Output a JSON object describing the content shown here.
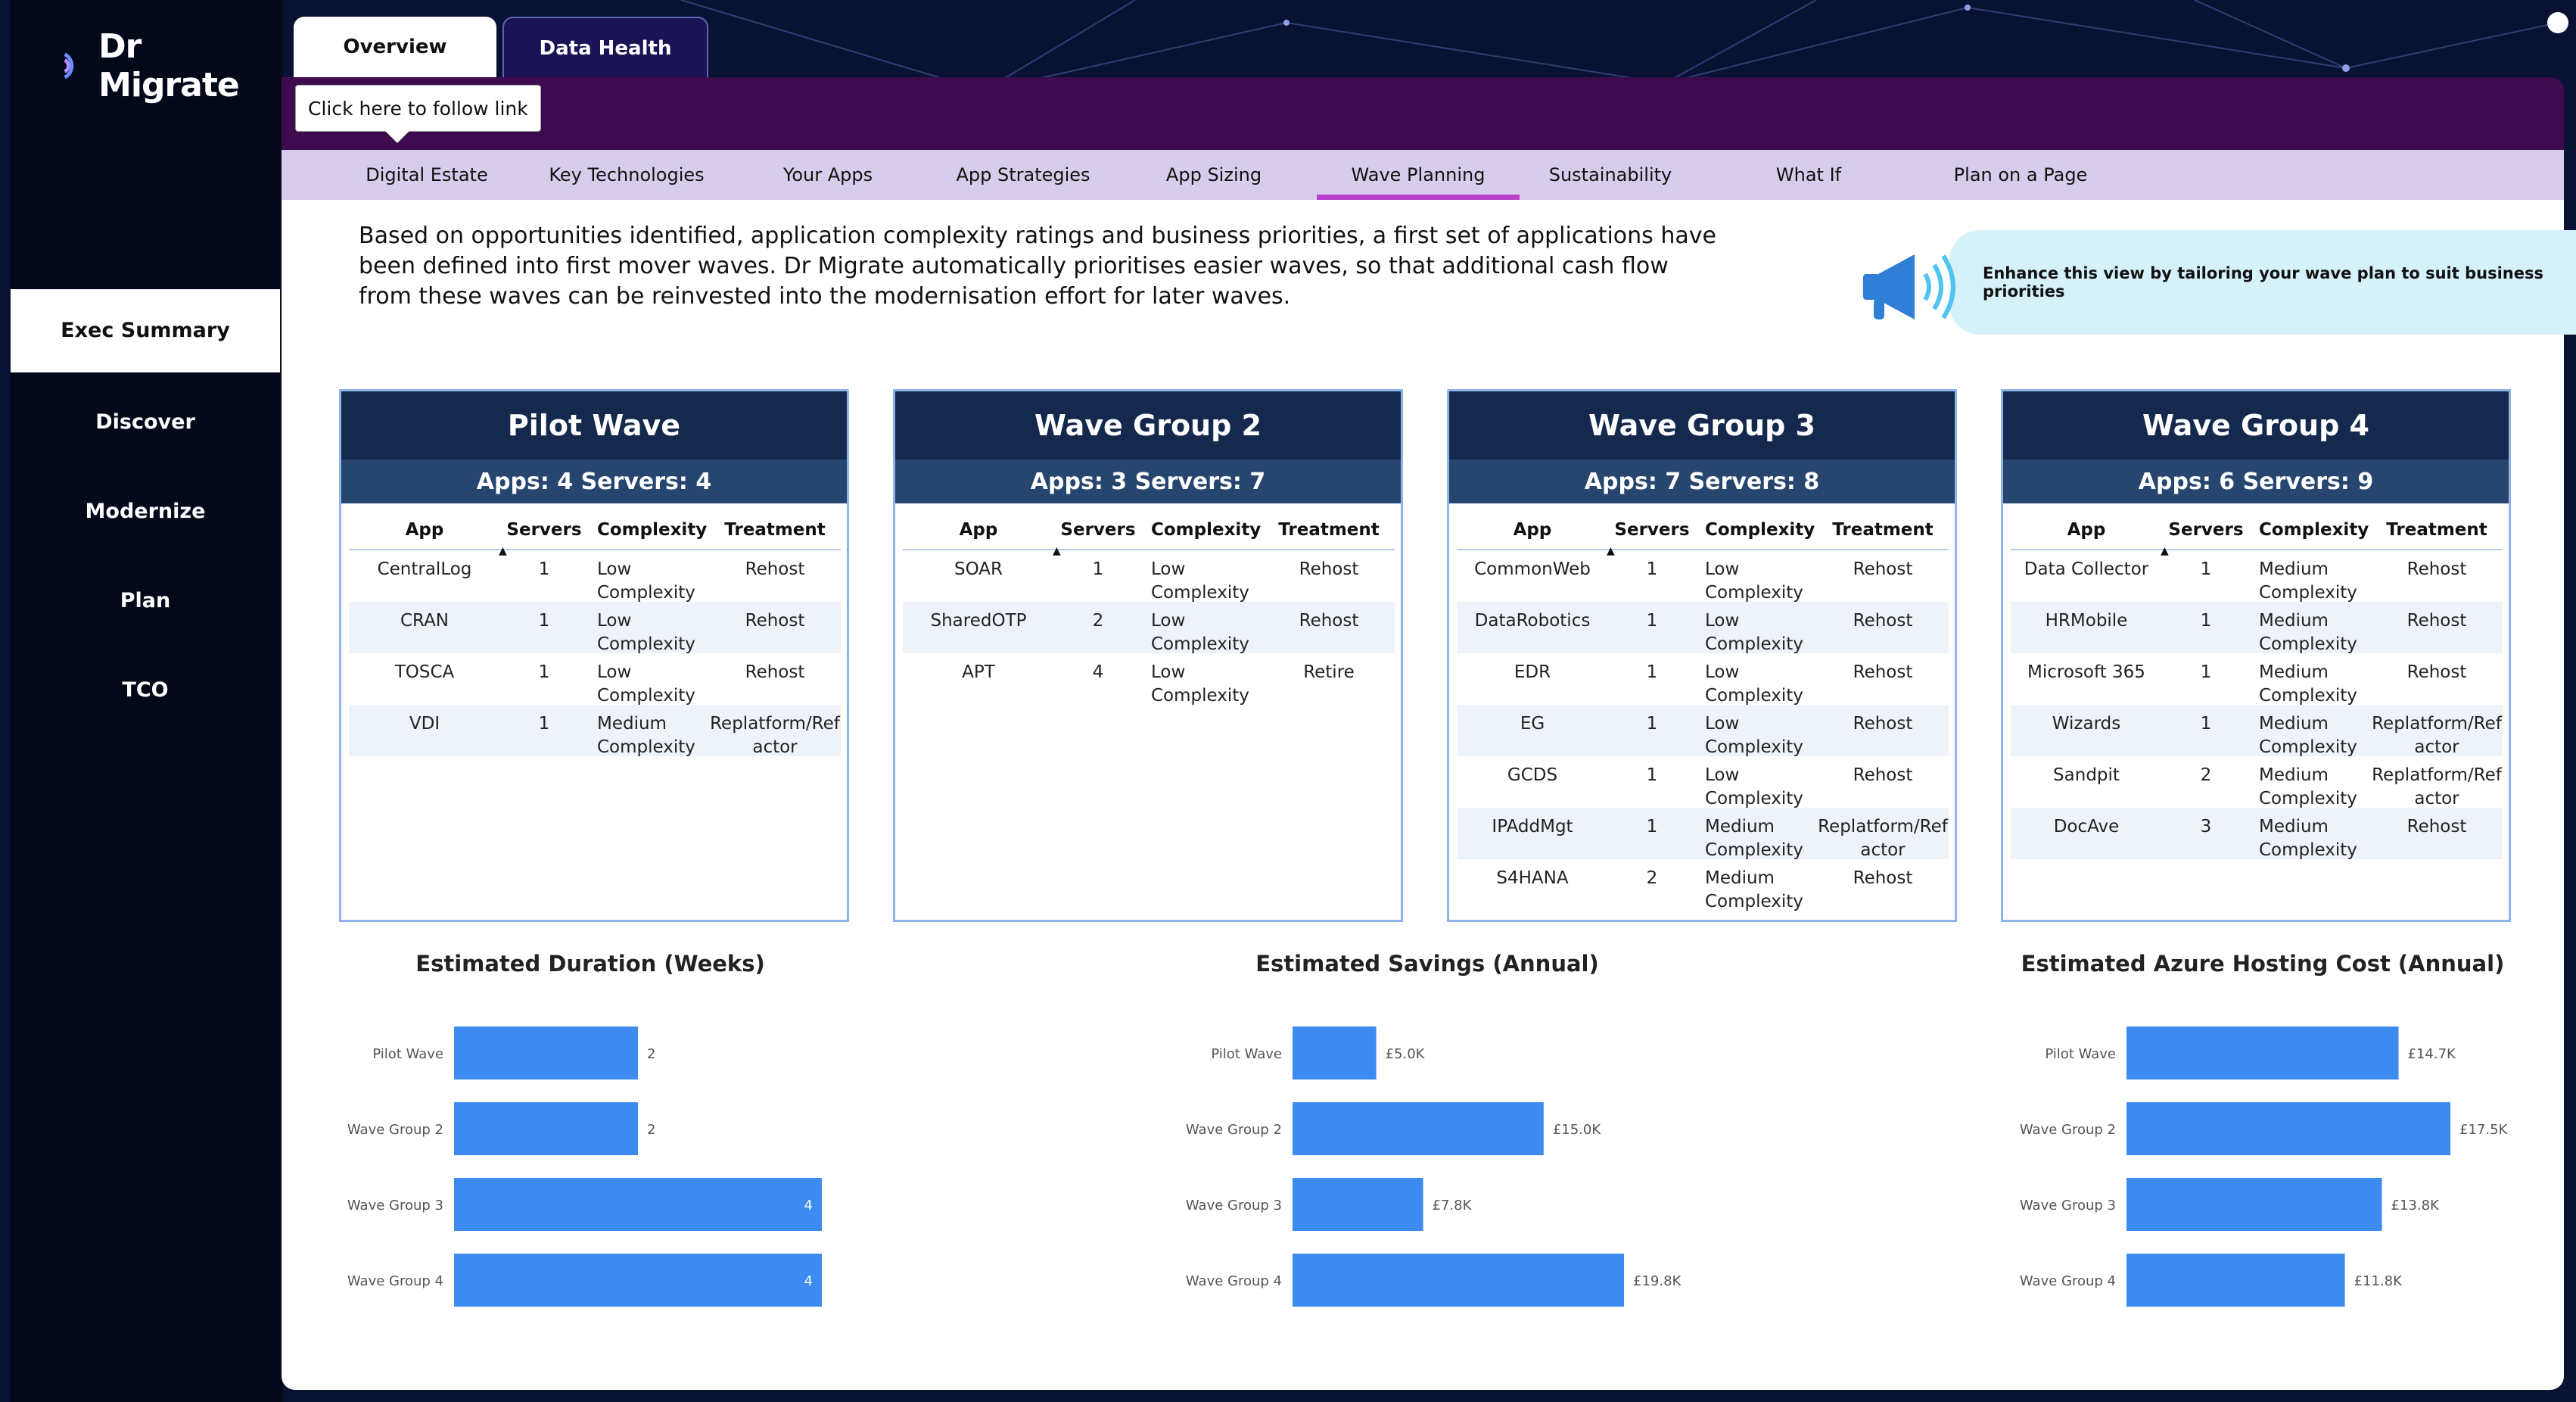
{
  "app": {
    "logo_text": "Dr Migrate"
  },
  "sidebar": {
    "items": [
      {
        "label": "Exec Summary",
        "active": true
      },
      {
        "label": "Discover"
      },
      {
        "label": "Modernize"
      },
      {
        "label": "Plan"
      },
      {
        "label": "TCO"
      }
    ]
  },
  "top_tabs": {
    "overview": "Overview",
    "data_health": "Data Health"
  },
  "tooltip": "Click here to follow link",
  "subnav": {
    "items": [
      {
        "label": "Digital Estate"
      },
      {
        "label": "Key Technologies"
      },
      {
        "label": "Your Apps"
      },
      {
        "label": "App Strategies"
      },
      {
        "label": "App Sizing"
      },
      {
        "label": "Wave Planning",
        "active": true
      },
      {
        "label": "Sustainability"
      },
      {
        "label": "What If"
      },
      {
        "label": "Plan on a Page"
      }
    ]
  },
  "intro": "Based on opportunities identified, application complexity ratings and business priorities, a first set of applications have been defined into first mover waves. Dr Migrate automatically prioritises easier waves, so that additional cash flow from these waves can be reinvested into the modernisation effort for later waves.",
  "banner": {
    "text": "Enhance this view by tailoring your wave plan to suit business priorities",
    "icon": "megaphone-icon"
  },
  "table_headers": {
    "app": "App",
    "servers": "Servers",
    "complexity": "Complexity",
    "treatment": "Treatment"
  },
  "waves": [
    {
      "title": "Pilot Wave",
      "summary": "Apps: 4 Servers: 4",
      "rows": [
        {
          "app": "CentralLog",
          "servers": "1",
          "complexity": "Low Complexity",
          "treatment": "Rehost"
        },
        {
          "app": "CRAN",
          "servers": "1",
          "complexity": "Low Complexity",
          "treatment": "Rehost"
        },
        {
          "app": "TOSCA",
          "servers": "1",
          "complexity": "Low Complexity",
          "treatment": "Rehost"
        },
        {
          "app": "VDI",
          "servers": "1",
          "complexity": "Medium Complexity",
          "treatment": "Replatform/Refactor"
        }
      ]
    },
    {
      "title": "Wave Group 2",
      "summary": "Apps: 3 Servers: 7",
      "rows": [
        {
          "app": "SOAR",
          "servers": "1",
          "complexity": "Low Complexity",
          "treatment": "Rehost"
        },
        {
          "app": "SharedOTP",
          "servers": "2",
          "complexity": "Low Complexity",
          "treatment": "Rehost"
        },
        {
          "app": "APT",
          "servers": "4",
          "complexity": "Low Complexity",
          "treatment": "Retire"
        }
      ]
    },
    {
      "title": "Wave Group 3",
      "summary": "Apps: 7 Servers: 8",
      "rows": [
        {
          "app": "CommonWeb",
          "servers": "1",
          "complexity": "Low Complexity",
          "treatment": "Rehost"
        },
        {
          "app": "DataRobotics",
          "servers": "1",
          "complexity": "Low Complexity",
          "treatment": "Rehost"
        },
        {
          "app": "EDR",
          "servers": "1",
          "complexity": "Low Complexity",
          "treatment": "Rehost"
        },
        {
          "app": "EG",
          "servers": "1",
          "complexity": "Low Complexity",
          "treatment": "Rehost"
        },
        {
          "app": "GCDS",
          "servers": "1",
          "complexity": "Low Complexity",
          "treatment": "Rehost"
        },
        {
          "app": "IPAddMgt",
          "servers": "1",
          "complexity": "Medium Complexity",
          "treatment": "Replatform/Refactor"
        },
        {
          "app": "S4HANA",
          "servers": "2",
          "complexity": "Medium Complexity",
          "treatment": "Rehost"
        }
      ]
    },
    {
      "title": "Wave Group 4",
      "summary": "Apps: 6 Servers: 9",
      "rows": [
        {
          "app": "Data Collector",
          "servers": "1",
          "complexity": "Medium Complexity",
          "treatment": "Rehost"
        },
        {
          "app": "HRMobile",
          "servers": "1",
          "complexity": "Medium Complexity",
          "treatment": "Rehost"
        },
        {
          "app": "Microsoft 365",
          "servers": "1",
          "complexity": "Medium Complexity",
          "treatment": "Rehost"
        },
        {
          "app": "Wizards",
          "servers": "1",
          "complexity": "Medium Complexity",
          "treatment": "Replatform/Refactor"
        },
        {
          "app": "Sandpit",
          "servers": "2",
          "complexity": "Medium Complexity",
          "treatment": "Replatform/Refactor"
        },
        {
          "app": "DocAve",
          "servers": "3",
          "complexity": "Medium Complexity",
          "treatment": "Rehost"
        }
      ]
    }
  ],
  "chart_data": [
    {
      "type": "bar",
      "orientation": "horizontal",
      "title": "Estimated Duration (Weeks)",
      "categories": [
        "Pilot Wave",
        "Wave Group 2",
        "Wave Group 3",
        "Wave Group 4"
      ],
      "values": [
        2,
        2,
        4,
        4
      ],
      "labels": [
        "2",
        "2",
        "4",
        "4"
      ],
      "xlim": [
        0,
        4
      ],
      "label_position": [
        "outside",
        "outside",
        "inside",
        "inside"
      ],
      "color": "#3d8af0"
    },
    {
      "type": "bar",
      "orientation": "horizontal",
      "title": "Estimated Savings (Annual)",
      "categories": [
        "Pilot Wave",
        "Wave Group 2",
        "Wave Group 3",
        "Wave Group 4"
      ],
      "values": [
        5000,
        15000,
        7800,
        19800
      ],
      "labels": [
        "£5.0K",
        "£15.0K",
        "£7.8K",
        "£19.8K"
      ],
      "xlim": [
        0,
        19800
      ],
      "label_position": [
        "outside",
        "outside",
        "outside",
        "outside"
      ],
      "color": "#3d8af0"
    },
    {
      "type": "bar",
      "orientation": "horizontal",
      "title": "Estimated Azure Hosting Cost (Annual)",
      "categories": [
        "Pilot Wave",
        "Wave Group 2",
        "Wave Group 3",
        "Wave Group 4"
      ],
      "values": [
        14700,
        17500,
        13800,
        11800
      ],
      "labels": [
        "£14.7K",
        "£17.5K",
        "£13.8K",
        "£11.8K"
      ],
      "xlim": [
        0,
        17500
      ],
      "label_position": [
        "outside",
        "outside",
        "outside",
        "outside"
      ],
      "color": "#3d8af0"
    }
  ]
}
